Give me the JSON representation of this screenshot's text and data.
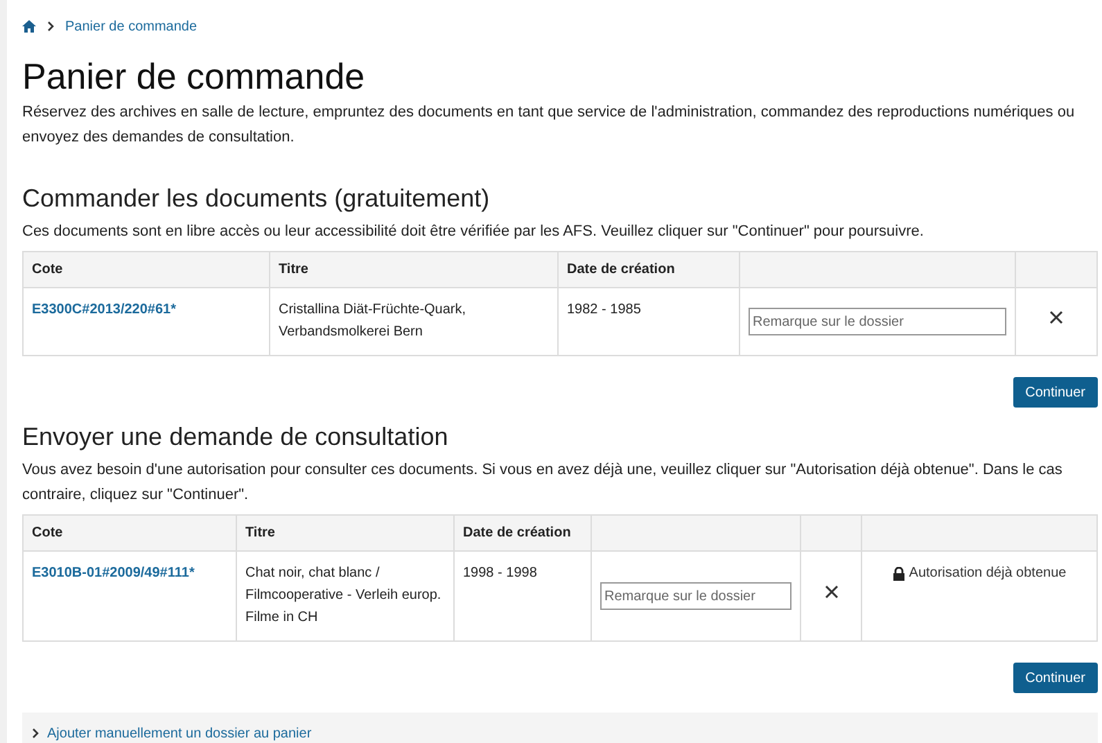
{
  "breadcrumb": {
    "items": [
      "Panier de commande"
    ]
  },
  "page": {
    "title": "Panier de commande",
    "intro": "Réservez des archives en salle de lecture, empruntez des documents en tant que service de l'administration, commandez des reproductions numériques ou envoyez des demandes de consultation."
  },
  "sections": [
    {
      "heading": "Commander les documents (gratuitement)",
      "intro": "Ces documents sont en libre accès ou leur accessibilité doit être vérifiée par les AFS. Veuillez cliquer sur \"Continuer\" pour poursuivre.",
      "kind": "plain",
      "columns": [
        "Cote",
        "Titre",
        "Date de création"
      ],
      "rows": [
        {
          "cote": "E3300C#2013/220#61*",
          "titre": "Cristallina Diät-Früchte-Quark, Verbandsmolkerei Bern",
          "date": "1982 - 1985",
          "remark_placeholder": "Remarque sur le dossier"
        }
      ],
      "button": "Continuer"
    },
    {
      "heading": "Envoyer une demande de consultation",
      "intro": "Vous avez besoin d'une autorisation pour consulter ces documents. Si vous en avez déjà une, veuillez cliquer sur \"Autorisation déjà obtenue\". Dans le cas contraire, cliquez sur \"Continuer\".",
      "kind": "authorization",
      "columns": [
        "Cote",
        "Titre",
        "Date de création"
      ],
      "rows": [
        {
          "cote": "E3010B-01#2009/49#111*",
          "titre": "Chat noir, chat blanc / Filmcooperative - Verleih europ. Filme in CH",
          "date": "1998 - 1998",
          "remark_placeholder": "Remarque sur le dossier",
          "authorization": "Autorisation déjà obtenue"
        }
      ],
      "button": "Continuer"
    }
  ],
  "add_manual": {
    "label": "Ajouter manuellement un dossier au panier"
  }
}
